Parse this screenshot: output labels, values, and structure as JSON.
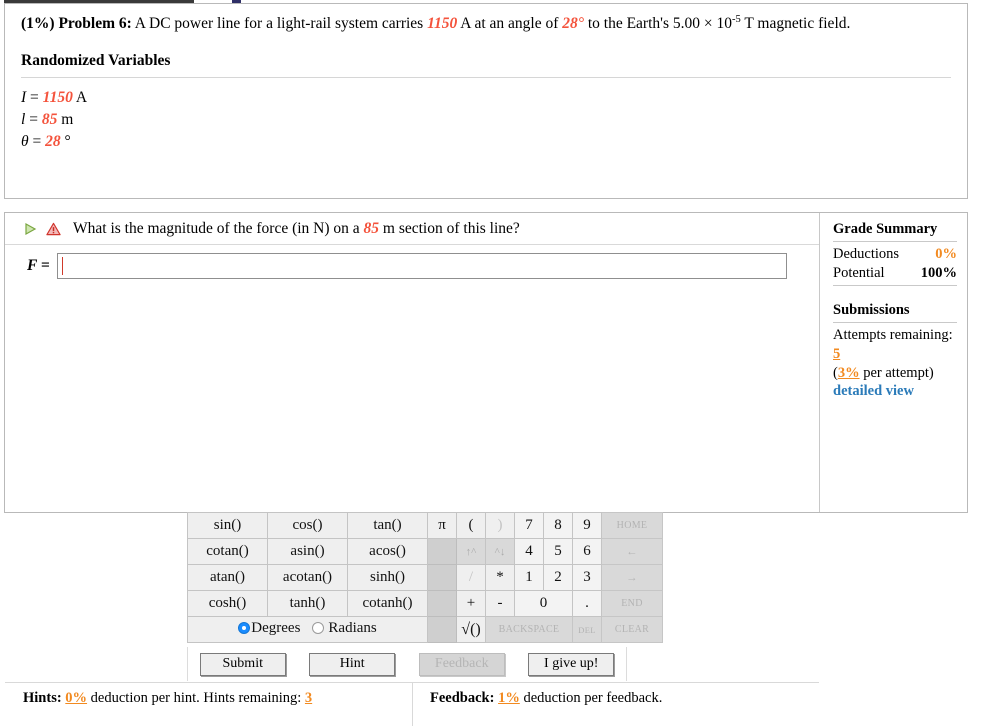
{
  "problem": {
    "weight": "(1%)",
    "label": "Problem 6:",
    "text_before_current": " A DC power line for a light-rail system carries ",
    "current": "1150",
    "text_after_current": " A at an angle of ",
    "angle": "28°",
    "text_after_angle": " to the Earth's 5.00 × 10",
    "exponent": "-5",
    "text_end": " T magnetic field."
  },
  "randomized": {
    "heading": "Randomized Variables",
    "variables": [
      {
        "name": "I",
        "eq": "=",
        "value": "1150",
        "unit": "A"
      },
      {
        "name": "l",
        "eq": "=",
        "value": "85",
        "unit": "m"
      },
      {
        "name": "θ",
        "eq": "=",
        "value": "28",
        "unit": "°"
      }
    ]
  },
  "question": {
    "play_icon": "play-triangle-icon",
    "warning_icon": "warning-triangle-icon",
    "text_before_value": "What is the magnitude of the force (in N) on a ",
    "value": "85",
    "text_after_value": " m section of this line?"
  },
  "answer": {
    "label": "F =",
    "value": "",
    "placeholder": ""
  },
  "keypad": {
    "functions": [
      [
        "sin()",
        "cos()",
        "tan()"
      ],
      [
        "cotan()",
        "asin()",
        "acos()"
      ],
      [
        "atan()",
        "acotan()",
        "sinh()"
      ],
      [
        "cosh()",
        "tanh()",
        "cotanh()"
      ]
    ],
    "pi": "π",
    "paren_open": "(",
    "paren_close": ")",
    "superscript": "↑^",
    "subscript": "^↓",
    "divide": "/",
    "multiply": "*",
    "plus": "+",
    "minus": "-",
    "sqrt": "√()",
    "digits": {
      "r1": [
        "7",
        "8",
        "9"
      ],
      "r2": [
        "4",
        "5",
        "6"
      ],
      "r3": [
        "1",
        "2",
        "3"
      ],
      "zero": "0",
      "dot": "."
    },
    "nav": {
      "home": "HOME",
      "left": "←",
      "right": "→",
      "end": "END",
      "backspace": "BACKSPACE",
      "del": "DEL",
      "clear": "CLEAR"
    },
    "angle_mode": {
      "degrees": "Degrees",
      "radians": "Radians",
      "selected": "Degrees"
    }
  },
  "actions": {
    "submit": "Submit",
    "hint": "Hint",
    "feedback": "Feedback",
    "give_up": "I give up!"
  },
  "footer": {
    "hints_label": "Hints:",
    "hints_deduction": "0%",
    "hints_text_mid": " deduction per hint. Hints remaining: ",
    "hints_remaining": "3",
    "feedback_label": "Feedback:",
    "feedback_deduction": "1%",
    "feedback_text": " deduction per feedback."
  },
  "grade_summary": {
    "title": "Grade Summary",
    "deductions_label": "Deductions",
    "deductions_value": "0%",
    "potential_label": "Potential",
    "potential_value": "100%",
    "submissions_title": "Submissions",
    "attempts_label": "Attempts remaining:",
    "attempts_value": "5",
    "per_attempt_open": "(",
    "per_attempt_value": "3%",
    "per_attempt_text": " per attempt)",
    "detailed_view": "detailed view"
  },
  "colors": {
    "randomized_value": "#f4533c",
    "orange_value": "#f28a20",
    "link_blue": "#2b7bb9",
    "radio_blue": "#1a8cff"
  }
}
